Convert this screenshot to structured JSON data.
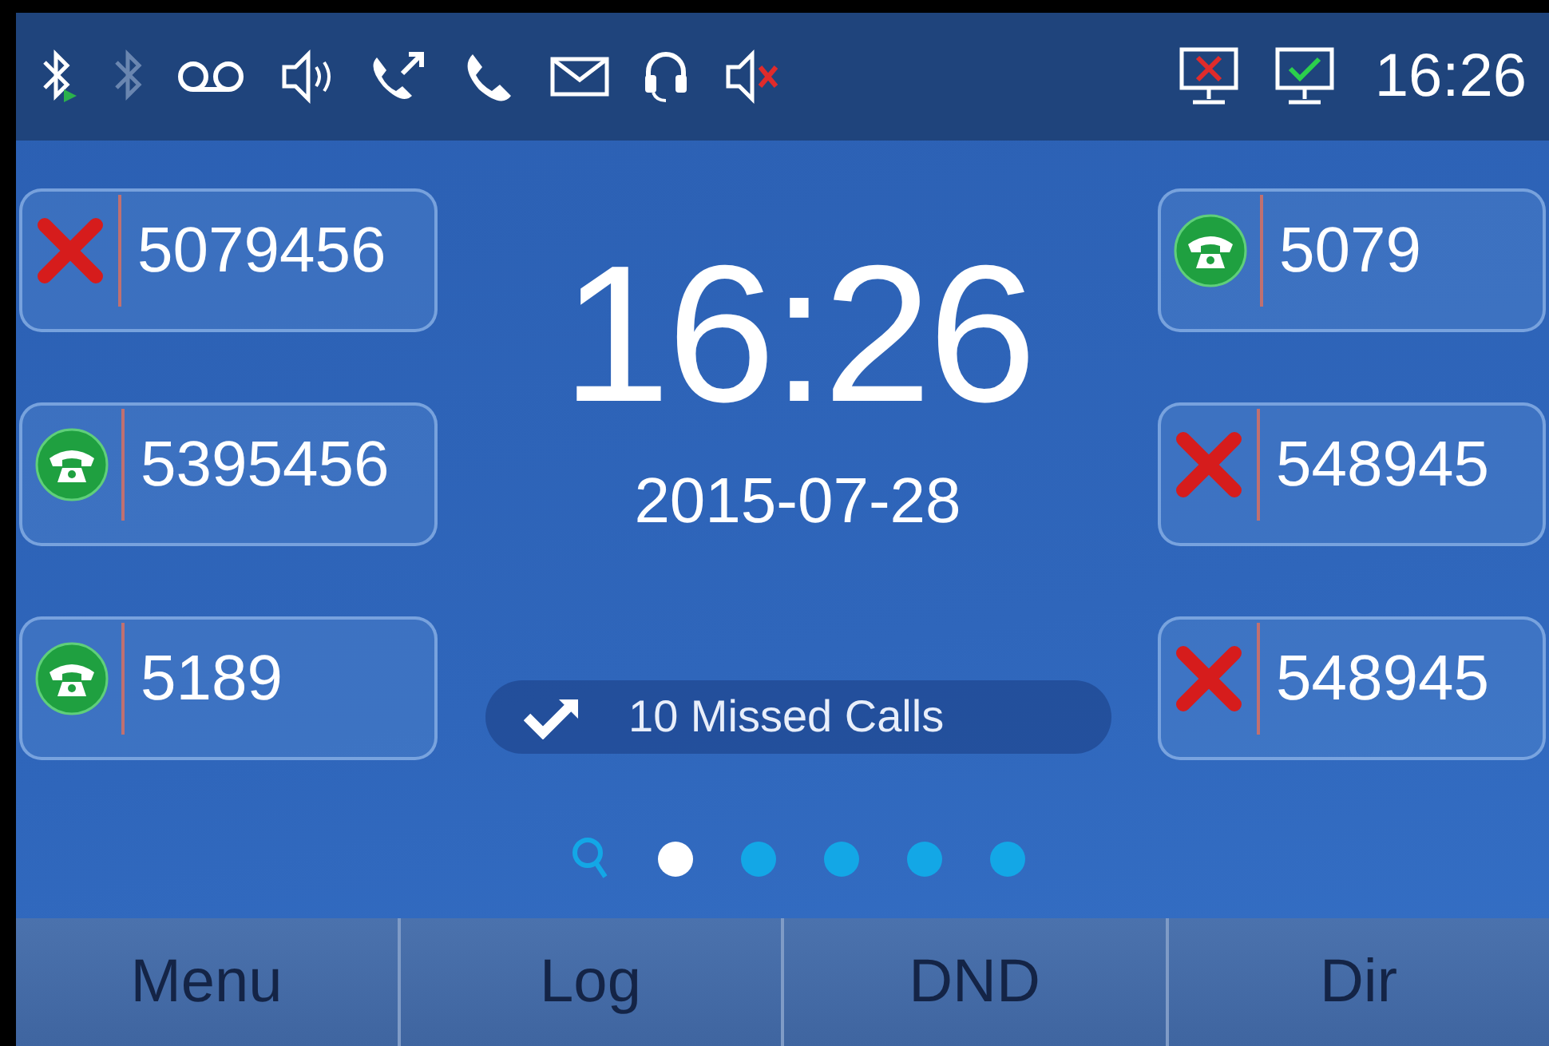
{
  "status_bar": {
    "time": "16:26"
  },
  "left_keys": [
    {
      "number": "5079456",
      "kind": "missed"
    },
    {
      "number": "5395456",
      "kind": "answered"
    },
    {
      "number": "5189",
      "kind": "answered"
    }
  ],
  "clock": {
    "time": "16:26",
    "date": "2015-07-28"
  },
  "notification": {
    "text": "10 Missed Calls"
  },
  "right_keys": [
    {
      "number": "5079",
      "kind": "answered"
    },
    {
      "number": "548945",
      "kind": "missed"
    },
    {
      "number": "548945",
      "kind": "missed"
    }
  ],
  "page_dots": [
    {
      "selected": true
    },
    {
      "selected": false
    },
    {
      "selected": false
    },
    {
      "selected": false
    },
    {
      "selected": false
    }
  ],
  "softkeys": [
    "Menu",
    "Log",
    "DND",
    "Dir"
  ]
}
